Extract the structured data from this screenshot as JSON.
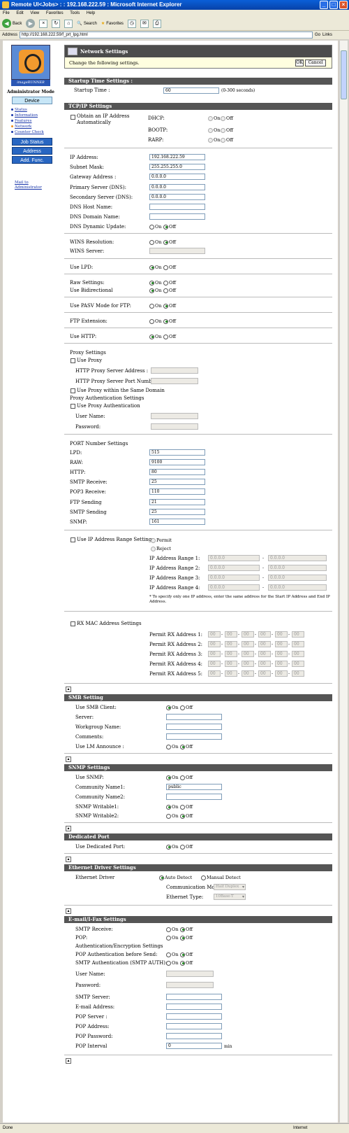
{
  "window": {
    "title": "Remote UI<Jobs> : : 192.168.222.59 : Microsoft Internet Explorer"
  },
  "menu": [
    "File",
    "Edit",
    "View",
    "Favorites",
    "Tools",
    "Help"
  ],
  "toolbar": {
    "back": "Back",
    "search": "Search",
    "favorites": "Favorites"
  },
  "address": {
    "label": "Address",
    "url": "http://192.168.222.59/f_prt_lpg.html",
    "go": "Go",
    "links": "Links"
  },
  "status": {
    "left": "Done",
    "right": "Internet"
  },
  "sidebar": {
    "brand": "imageRUNNER",
    "mode": "Administrator Mode",
    "device": "Device",
    "links": [
      "Status",
      "Information",
      "Features",
      "Network",
      "Counter Check"
    ],
    "buttons": [
      "Job Status",
      "Address",
      "Add. Func."
    ],
    "mail": "Mail to Administrator"
  },
  "header": {
    "title": "Network Settings",
    "message": "Change the following settings.",
    "ok": "OK",
    "cancel": "Cancel"
  },
  "startup": {
    "section": "Startup Time Settings :",
    "label": "Startup Time :",
    "value": "60",
    "range": "(0-300 seconds)"
  },
  "tcpip": {
    "section": "TCP/IP Settings",
    "obtain": "Obtain an IP Address Automatically",
    "protocols": [
      "DHCP:",
      "BOOTP:",
      "RARP:"
    ],
    "on": "On",
    "off": "Off",
    "fields": [
      {
        "label": "IP Address:",
        "value": "192.168.222.59"
      },
      {
        "label": "Subnet Mask:",
        "value": "255.255.255.0"
      },
      {
        "label": "Gateway Address :",
        "value": "0.0.0.0"
      },
      {
        "label": "Primary Server (DNS):",
        "value": "0.0.0.0"
      },
      {
        "label": "Secondary Server (DNS):",
        "value": "0.0.0.0"
      },
      {
        "label": "DNS Host Name:",
        "value": ""
      },
      {
        "label": "DNS Domain Name:",
        "value": ""
      }
    ],
    "dns_dynamic": "DNS Dynamic Update:",
    "wins_res": "WINS Resolution:",
    "wins_server": "WINS Server:",
    "use_lpd": "Use LPD:",
    "raw": "Raw Settings:",
    "bidir": "Use Bidirectional",
    "pasv": "Use PASV Mode for FTP:",
    "ftp_ext": "FTP Extension:",
    "use_http": "Use HTTP:",
    "proxy": "Proxy Settings",
    "use_proxy": "Use Proxy",
    "proxy_addr": "HTTP Proxy Server Address :",
    "proxy_port": "HTTP Proxy Server Port Number :",
    "proxy_domain": "Use Proxy within the Same Domain",
    "proxy_auth_title": "Proxy Authentication Settings",
    "proxy_auth": "Use Proxy Authentication",
    "user_name": "User Name:",
    "password": "Password:",
    "port_title": "PORT Number Settings",
    "ports": [
      {
        "label": "LPD:",
        "value": "515"
      },
      {
        "label": "RAW:",
        "value": "9100"
      },
      {
        "label": "HTTP:",
        "value": "80"
      },
      {
        "label": "SMTP Receive:",
        "value": "25"
      },
      {
        "label": "POP3 Receive:",
        "value": "110"
      },
      {
        "label": "FTP Sending",
        "value": "21"
      },
      {
        "label": "SMTP Sending",
        "value": "25"
      },
      {
        "label": "SNMP:",
        "value": "161"
      }
    ],
    "ip_range": "Use IP Address Range Settings",
    "permit": "Permit",
    "reject": "Reject",
    "ranges": [
      "IP Address Range 1:",
      "IP Address Range 2:",
      "IP Address Range 3:",
      "IP Address Range 4:"
    ],
    "range_placeholder": "0.0.0.0",
    "range_note": "* To specify only one IP address, enter the same address for the Start IP Address and End IP Address.",
    "mac": "RX MAC Address Settings",
    "mac_rows": [
      "Permit RX Address 1:",
      "Permit RX Address 2:",
      "Permit RX Address 3:",
      "Permit RX Address 4:",
      "Permit RX Address 5:"
    ],
    "mac_placeholder": "00"
  },
  "smb": {
    "section": "SMB Setting",
    "use": "Use SMB Client:",
    "server": "Server:",
    "workgroup": "Workgroup Name:",
    "comments": "Comments:",
    "lm": "Use LM Announce :"
  },
  "snmp": {
    "section": "SNMP Settings",
    "use": "Use SNMP:",
    "c1": "Community Name1:",
    "c1v": "public",
    "c2": "Community Name2:",
    "w1": "SNMP Writable1:",
    "w2": "SNMP Writable2:"
  },
  "dedicated": {
    "section": "Dedicated Port",
    "use": "Use Dedicated Port:"
  },
  "ethernet": {
    "section": "Ethernet Driver Settings",
    "driver": "Ethernet Driver",
    "auto": "Auto Detect",
    "manual": "Manual Detect",
    "comm": "Communication Mode:",
    "comm_v": "Half Duplex",
    "type": "Ethernet Type:",
    "type_v": "10Base-T"
  },
  "email": {
    "section": "E-mail/I-Fax Settings",
    "smtp_rx": "SMTP Receive:",
    "pop": "POP:",
    "auth_title": "Authentication/Encryption Settings",
    "pop_before": "POP Authentication before Send:",
    "smtp_auth": "SMTP Authentication (SMTP AUTH):",
    "user": "User Name:",
    "pass": "Password:",
    "smtp_server": "SMTP Server:",
    "email_addr": "E-mail Address:",
    "pop_server": "POP Server :",
    "pop_addr": "POP Address:",
    "pop_pass": "POP Password:",
    "pop_int": "POP Interval",
    "pop_int_v": "0",
    "min": "min"
  },
  "colors": {
    "section": "#555555",
    "nav": "#2866c2",
    "header_bg": "#fffedf"
  }
}
